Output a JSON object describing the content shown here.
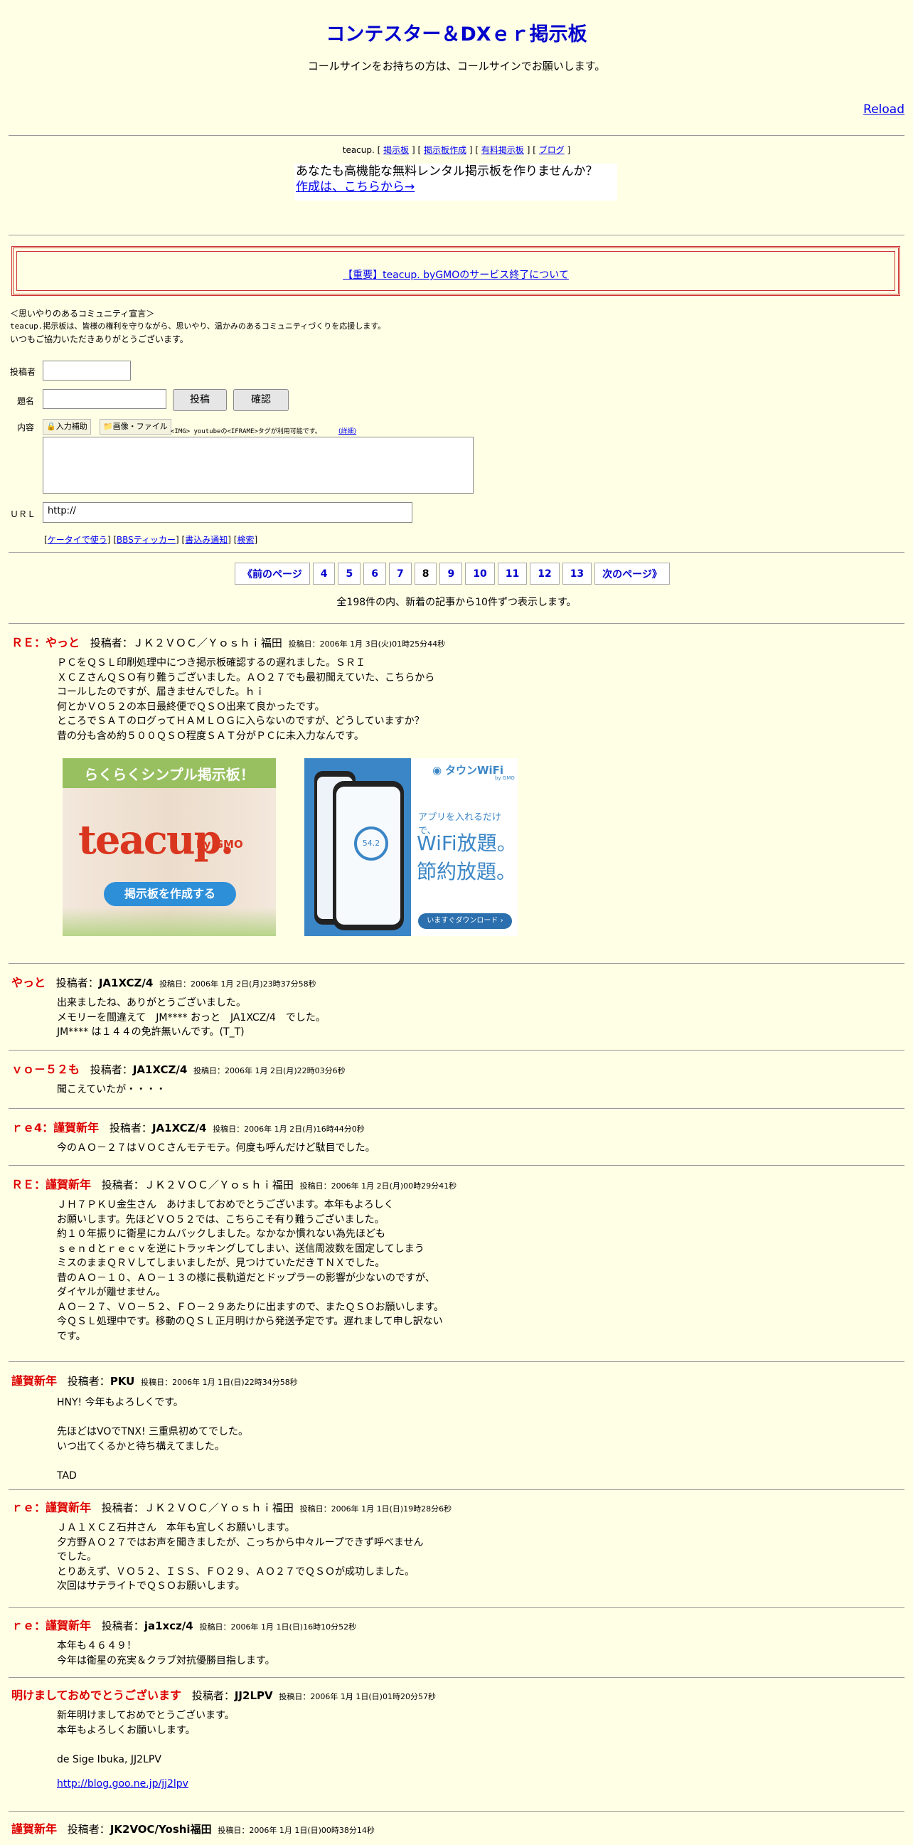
{
  "header": {
    "title": "コンテスター＆DXｅｒ掲示板",
    "subtitle": "コールサインをお持ちの方は、コールサインでお願いします。",
    "reload": "Reload"
  },
  "teacup_nav": {
    "prefix": "teacup. [",
    "links": [
      "掲示板",
      "掲示板作成",
      "有料掲示板",
      "ブログ"
    ],
    "sep": "] [",
    "suffix": "]"
  },
  "ad": {
    "line1": "あなたも高機能な無料レンタル掲示板を作りませんか？",
    "line2": "作成は、こちらから→"
  },
  "notice": "【重要】teacup. byGMOのサービス終了について",
  "community": [
    "＜思いやりのあるコミュニティ宣言＞",
    "teacup.掲示板は、皆様の権利を守りながら、思いやり、温かみのあるコミュニティづくりを応援します。",
    "いつもご協力いただきありがとうございます。"
  ],
  "form": {
    "author_label": "投稿者",
    "subject_label": "題名",
    "content_label": "内容",
    "url_label": "ＵＲＬ",
    "submit": "投稿",
    "confirm": "確認",
    "input_help": "入力補助",
    "image_file": "画像・ファイル",
    "tag_note": "<IMG> youtubeの<IFRAME>タグが利用可能です。",
    "tag_detail": "(詳細)",
    "url_value": "http://",
    "links": [
      "ケータイで使う",
      "BBSティッカー",
      "書込み通知",
      "検索"
    ]
  },
  "pager": {
    "prev": "《前のページ",
    "pages": [
      "4",
      "5",
      "6",
      "7",
      "8",
      "9",
      "10",
      "11",
      "12",
      "13"
    ],
    "current": "8",
    "next": "次のページ》",
    "info": "全198件の内、新着の記事から10件ずつ表示します。"
  },
  "banners": {
    "left_title": "らくらくシンプル掲示板！",
    "left_logo": "teacup.",
    "left_by": "by GMO",
    "left_button": "掲示板を作成する",
    "right_brand": "タウンWiFi",
    "right_by": "by GMO",
    "right_line1": "アプリを入れるだけで、",
    "right_line2": "WiFi放題。",
    "right_line3": "節約放題。",
    "right_button": "いますぐダウンロード ›",
    "phone_value": "54.2"
  },
  "posts": [
    {
      "title": "ＲＥ：やっと",
      "author_prefix": "投稿者：",
      "author": "ＪＫ２ＶＯＣ／Ｙｏｓｈｉ福田",
      "date": "投稿日：2006年 1月 3日(火)01時25分44秒",
      "body": "ＰＣをＱＳＬ印刷処理中につき掲示板確認するの遅れました。ＳＲＩ\nＸＣＺさんＱＳＯ有り難うございました。ＡＯ２７でも最初聞えていた、こちらから\nコールしたのですが、届きませんでした。ｈｉ\n何とかＶＯ５２の本日最終便でＱＳＯ出来て良かったです。\nところでＳＡＴのログってＨＡＭＬＯＧに入らないのですが、どうしていますか？\n昔の分も含め約５００ＱＳＯ程度ＳＡＴ分がＰＣに未入力なんです。"
    },
    {
      "title": "やっと",
      "author_prefix": "投稿者：",
      "author": "JA1XCZ/4",
      "date": "投稿日：2006年 1月 2日(月)23時37分58秒",
      "body": "出来ましたね、ありがとうございました。\nメモリーを間違えて　JM**** おっと　JA1XCZ/4　でした。\nJM**** は１４４の免許無いんです。(T_T)"
    },
    {
      "title": "ｖｏ－５２も",
      "author_prefix": "投稿者：",
      "author": "JA1XCZ/4",
      "date": "投稿日：2006年 1月 2日(月)22時03分6秒",
      "body": "聞こえていたが・・・・"
    },
    {
      "title": "ｒｅ4：謹賀新年",
      "author_prefix": "投稿者：",
      "author": "JA1XCZ/4",
      "date": "投稿日：2006年 1月 2日(月)16時44分0秒",
      "body": "今のＡＯ－２７はＶＯＣさんモテモテ。何度も呼んだけど駄目でした。"
    },
    {
      "title": "ＲＥ：謹賀新年",
      "author_prefix": "投稿者：",
      "author": "ＪＫ２ＶＯＣ／Ｙｏｓｈｉ福田",
      "date": "投稿日：2006年 1月 2日(月)00時29分41秒",
      "body": "ＪＨ７ＰＫＵ金生さん　あけましておめでとうございます。本年もよろしく\nお願いします。先ほどＶＯ５２では、こちらこそ有り難うございました。\n約１０年振りに衛星にカムバックしました。なかなか慣れない為先ほども\nｓｅｎｄとｒｅｃｖを逆にトラッキングしてしまい、送信周波数を固定してしまう\nミスのままＱＲＶしてしまいましたが、見つけていただきＴＮＸでした。\n昔のＡＯ－１０、ＡＯ－１３の様に長軌道だとドップラーの影響が少ないのですが、\nダイヤルが離せません。\nＡＯ－２７、ＶＯ－５２、ＦＯ－２９あたりに出ますので、またＱＳＯお願いします。\n今ＱＳＬ処理中です。移動のＱＳＬ正月明けから発送予定です。遅れまして申し訳ない\nです。"
    },
    {
      "title": "謹賀新年",
      "author_prefix": "投稿者：",
      "author": "PKU",
      "date": "投稿日：2006年 1月 1日(日)22時34分58秒",
      "body": "HNY! 今年もよろしくです。\n\n先ほどはVOでTNX! 三重県初めてでした。\nいつ出てくるかと待ち構えてました。\n\nTAD"
    },
    {
      "title": "ｒｅ：謹賀新年",
      "author_prefix": "投稿者：",
      "author": "ＪＫ２ＶＯＣ／Ｙｏｓｈｉ福田",
      "date": "投稿日：2006年 1月 1日(日)19時28分6秒",
      "body": "ＪＡ１ＸＣＺ石井さん　本年も宜しくお願いします。\n夕方野ＡＯ２７ではお声を聞きましたが、こっちから中々ループできず呼べません\nでした。\nとりあえず、ＶＯ５２、ＩＳＳ、ＦＯ２９、ＡＯ２７でＱＳＯが成功しました。\n次回はサテライトでＱＳＯお願いします。"
    },
    {
      "title": "ｒｅ：謹賀新年",
      "author_prefix": "投稿者：",
      "author": "ja1xcz/4",
      "date": "投稿日：2006年 1月 1日(日)16時10分52秒",
      "body": "本年も４６４９！\n今年は衛星の充実＆クラブ対抗優勝目指します。"
    },
    {
      "title": "明けましておめでとうございます",
      "author_prefix": "投稿者：",
      "author": "JJ2LPV",
      "date": "投稿日：2006年 1月 1日(日)01時20分57秒",
      "body": "新年明けましておめでとうございます。\n本年もよろしくお願いします。\n\nde Sige Ibuka, JJ2LPV",
      "link": "http://blog.goo.ne.jp/jj2lpv"
    },
    {
      "title": "謹賀新年",
      "author_prefix": "投稿者：",
      "author": "JK2VOC/Yoshi福田",
      "date": "投稿日：2006年 1月 1日(日)00時38分14秒",
      "body": ""
    }
  ],
  "colors": {
    "background": "#ffffe6",
    "title": "#0000cc",
    "post_title": "#dd0000",
    "notice_border": "#cc3333"
  }
}
